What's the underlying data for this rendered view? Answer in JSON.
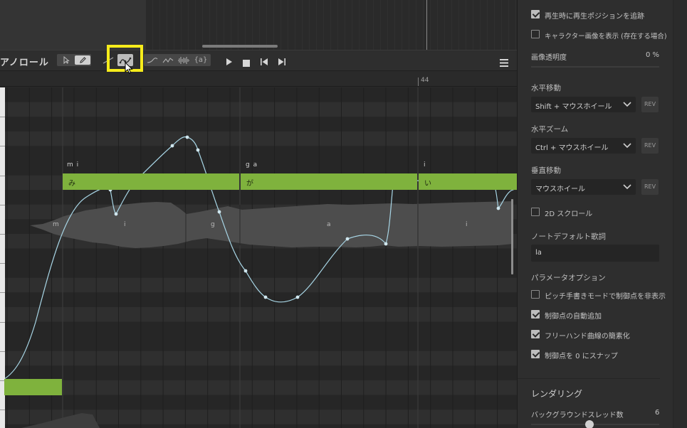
{
  "piano_roll": {
    "title": "アノロール",
    "measure_label": "44",
    "tool_icons": [
      "pointer-icon",
      "pencil-icon",
      "line-icon",
      "pitch-curve-icon",
      "vibrato-icon",
      "pitch-draw-icon",
      "waveform-icon",
      "phoneme-icon"
    ],
    "phoneme_button_label": "{a}",
    "transport_icons": [
      "play-icon",
      "stop-icon",
      "skip-back-icon",
      "skip-forward-icon"
    ],
    "menu_icon": "hamburger-menu-icon",
    "notes": [
      {
        "phonemes": "m i",
        "lyric": "み"
      },
      {
        "phonemes": "g a",
        "lyric": "が"
      },
      {
        "phonemes": "i",
        "lyric": "い"
      }
    ],
    "wave_phonemes": [
      "m",
      "i",
      "g",
      "a",
      "i"
    ]
  },
  "settings": {
    "follow_playhead": {
      "label": "再生時に再生ポジションを追跡",
      "checked": true
    },
    "show_character_image": {
      "label": "キャラクター画像を表示 (存在する場合)",
      "checked": false
    },
    "image_opacity": {
      "label": "画像透明度",
      "value": "0 %"
    },
    "horizontal_move": {
      "section": "水平移動",
      "value": "Shift + マウスホイール",
      "rev_label": "REV"
    },
    "horizontal_zoom": {
      "section": "水平ズーム",
      "value": "Ctrl + マウスホイール",
      "rev_label": "REV"
    },
    "vertical_move": {
      "section": "垂直移動",
      "value": "マウスホイール",
      "rev_label": "REV"
    },
    "scroll_2d": {
      "label": "2D スクロール",
      "checked": false
    },
    "note_default_lyric": {
      "section": "ノートデフォルト歌詞",
      "value": "la"
    },
    "param_options": {
      "section": "パラメータオプション"
    },
    "hide_control_points": {
      "label": "ピッチ手書きモードで制御点を非表示",
      "checked": false
    },
    "auto_add_points": {
      "label": "制御点の自動追加",
      "checked": true
    },
    "simplify_freehand": {
      "label": "フリーハンド曲線の簡素化",
      "checked": true
    },
    "snap_to_zero": {
      "label": "制御点を 0 にスナップ",
      "checked": true
    },
    "rendering": {
      "section": "レンダリング"
    },
    "bg_threads": {
      "label": "バックグラウンドスレッド数",
      "value": "6"
    }
  },
  "colors": {
    "accent_note": "#7fb23d",
    "highlight": "#f6ec1b",
    "pitch_curve": "#a8d6e6"
  }
}
